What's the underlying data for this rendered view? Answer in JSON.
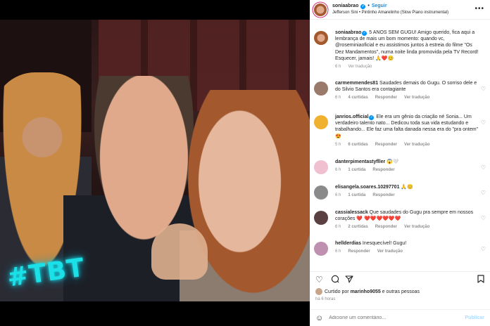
{
  "media": {
    "overlay_text": "#TBT",
    "mute_icon": "speaker-muted-icon"
  },
  "header": {
    "username": "soniaabrao",
    "follow_label": "Seguir",
    "audio": "Jefferson Sini • Pintinho Amarelinho (Slow Piano instrumental)",
    "more_label": "•••"
  },
  "caption": {
    "username": "soniaabrao",
    "text": " 5 ANOS SEM GUGU! Amigo querido, fica aqui a lembrança de mais um bom momento: quando vc, @roseminiaoficial e eu assistimos juntos à estreia do filme \"Os Dez Mandamentos\", numa noite linda promovida pela TV Record! Esquecer, jamais! 🙏❤️😊",
    "time": "6 h",
    "translate": "Ver tradução"
  },
  "comments": [
    {
      "user": "carmemmendes81",
      "text": " Saudades demais do Gugu. O sorriso dele e do Silvio Santos era contagiante",
      "time": "6 h",
      "likes": "4 curtidas",
      "reply": "Responder",
      "translate": "Ver tradução",
      "color": "#9a7a6a"
    },
    {
      "user": "janrios.official",
      "text": " Ele era um gênio da criação né Sonia... Um verdadeiro talento nato... Dedicou toda sua vida estudando e trabalhando... Ele faz uma falta danada nessa era do \"pra ontem\" 😍",
      "time": "5 h",
      "likes": "6 curtidas",
      "reply": "Responder",
      "translate": "Ver tradução",
      "color": "#f0b030"
    },
    {
      "user": "danterpimentastyfller",
      "text": " 😱🤍",
      "time": "6 h",
      "likes": "1 curtida",
      "reply": "Responder",
      "translate": "",
      "color": "#f0c0d0"
    },
    {
      "user": "elisangela.soares.10297701",
      "text": " 🙏😊",
      "time": "6 h",
      "likes": "1 curtida",
      "reply": "Responder",
      "translate": "",
      "color": "#8a8a8a"
    },
    {
      "user": "cassialessack",
      "text": " Que saudades do Gugu pra sempre em nossos corações ❤️ ❤️❤️❤️❤️❤️❤️",
      "time": "6 h",
      "likes": "2 curtidas",
      "reply": "Responder",
      "translate": "Ver tradução",
      "color": "#5a4040"
    },
    {
      "user": "hellderdias",
      "text": " Inesquecível! Gugu!",
      "time": "6 h",
      "likes": "",
      "reply": "Responder",
      "translate": "Ver tradução",
      "color": "#c090b0"
    }
  ],
  "footer": {
    "liked_prefix": "Curtido por ",
    "liked_user": "marinho9055",
    "liked_suffix": " e outras pessoas",
    "time": "há 6 horas",
    "comment_placeholder": "Adicione um comentário...",
    "publish_label": "Publicar"
  }
}
